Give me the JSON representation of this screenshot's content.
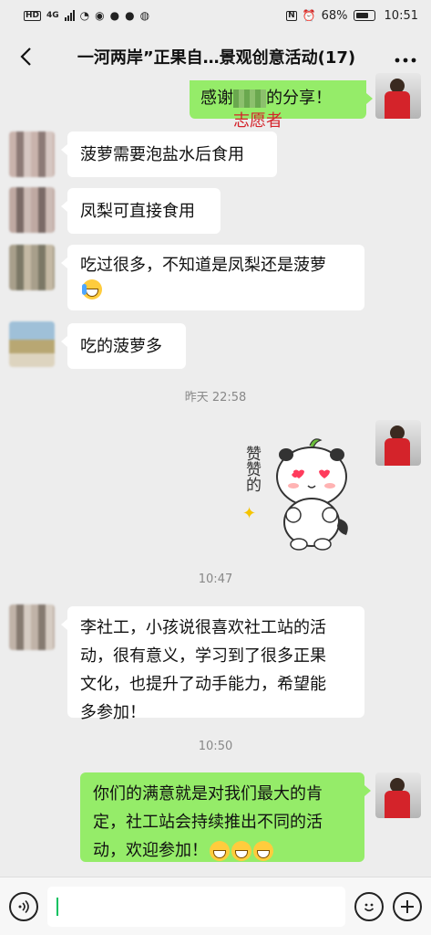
{
  "status_bar": {
    "network": "4G",
    "hd": "HD",
    "battery": "68%",
    "time": "10:51"
  },
  "header": {
    "title": "一河两岸”正果自…景观创意活动(17)",
    "back_icon": "chevron-left-icon",
    "more_icon": "more-icon"
  },
  "messages": [
    {
      "side": "right",
      "text": "感谢",
      "text_after": "的分享！",
      "stamp": "志愿者"
    },
    {
      "side": "left",
      "text": "菠萝需要泡盐水后食用"
    },
    {
      "side": "left",
      "text": "凤梨可直接食用"
    },
    {
      "side": "left",
      "line1": "吃过很多，不知道是凤梨还是菠萝"
    },
    {
      "side": "left",
      "text": "吃的菠萝多"
    },
    {
      "side": "left",
      "text": "李社工，小孩说很喜欢社工站的活动，很有意义，学习到了很多正果文化，也提升了动手能力，希望能多参加！",
      "lines": [
        "李社工，小孩说很喜欢社工站的活",
        "动，很有意义，学习到了很多正果",
        "文化，也提升了动手能力，希望能",
        "多参加！"
      ]
    },
    {
      "side": "right",
      "lines": [
        "你们的满意就是对我们最大的肯",
        "定，社工站会持续推出不同的活",
        "动，欢迎参加！"
      ]
    }
  ],
  "timestamps": [
    "昨天 22:58",
    "10:47",
    "10:50"
  ],
  "sticker": {
    "text": "赞赞的"
  },
  "input_bar": {
    "voice_icon": "voice-icon",
    "emoji_icon": "emoji-icon",
    "plus_icon": "plus-icon"
  },
  "colors": {
    "self_bubble": "#95ec69",
    "other_bubble": "#ffffff",
    "background": "#ededed",
    "stamp": "#d4232a"
  }
}
